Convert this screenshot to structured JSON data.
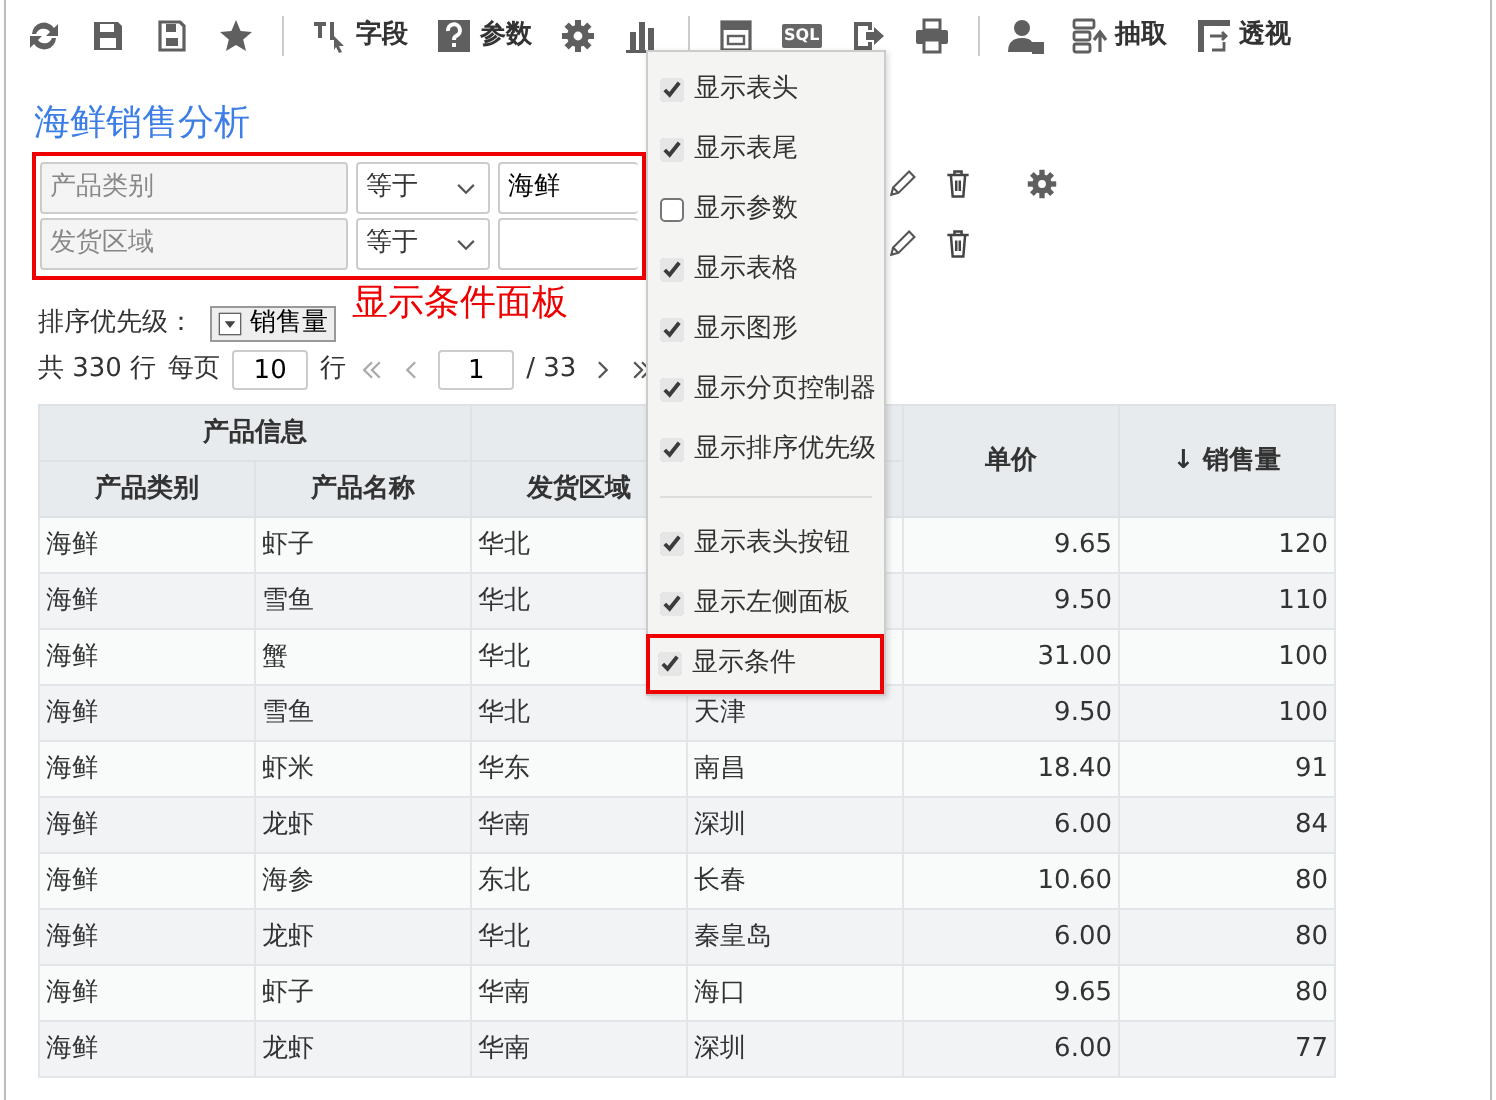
{
  "toolbar": {
    "fields_label": "字段",
    "params_label": "参数",
    "sql_text": "SQL",
    "extract_label": "抽取",
    "pivot_label": "透视"
  },
  "title": "海鲜销售分析",
  "conditions": [
    {
      "placeholder": "产品类别",
      "operator": "等于",
      "value": "海鲜",
      "has_settings": true
    },
    {
      "placeholder": "发货区域",
      "operator": "等于",
      "has_settings": false
    }
  ],
  "conditions_highlighted": true,
  "annotation": "显示条件面板",
  "sort": {
    "label": "排序优先级：",
    "field": "销售量"
  },
  "pagination": {
    "total": "共 330 行",
    "per_page_label": "每页",
    "per_page": "10",
    "rows_unit": "行",
    "page": "1",
    "pages": "/ 33"
  },
  "table": {
    "group_header": "产品信息",
    "columns": [
      "产品类别",
      "产品名称",
      "发货区域"
    ],
    "price_header": "单价",
    "sales_header": "销售量",
    "sort_arrow": "↓",
    "rows": [
      [
        "海鲜",
        "虾子",
        "华北",
        null,
        "9.65",
        "120"
      ],
      [
        "海鲜",
        "雪鱼",
        "华北",
        null,
        "9.50",
        "110"
      ],
      [
        "海鲜",
        "蟹",
        "华北",
        null,
        "31.00",
        "100"
      ],
      [
        "海鲜",
        "雪鱼",
        "华北",
        "天津",
        "9.50",
        "100"
      ],
      [
        "海鲜",
        "虾米",
        "华东",
        "南昌",
        "18.40",
        "91"
      ],
      [
        "海鲜",
        "龙虾",
        "华南",
        "深圳",
        "6.00",
        "84"
      ],
      [
        "海鲜",
        "海参",
        "东北",
        "长春",
        "10.60",
        "80"
      ],
      [
        "海鲜",
        "龙虾",
        "华北",
        "秦皇岛",
        "6.00",
        "80"
      ],
      [
        "海鲜",
        "虾子",
        "华南",
        "海口",
        "9.65",
        "80"
      ],
      [
        "海鲜",
        "龙虾",
        "华南",
        "深圳",
        "6.00",
        "77"
      ]
    ]
  },
  "menu": {
    "groups": [
      [
        {
          "label": "显示表头",
          "checked": true,
          "highlighted": false
        },
        {
          "label": "显示表尾",
          "checked": true,
          "highlighted": false
        },
        {
          "label": "显示参数",
          "checked": false,
          "highlighted": false
        },
        {
          "label": "显示表格",
          "checked": true,
          "highlighted": false
        },
        {
          "label": "显示图形",
          "checked": true,
          "highlighted": false
        },
        {
          "label": "显示分页控制器",
          "checked": true,
          "highlighted": false
        },
        {
          "label": "显示排序优先级",
          "checked": true,
          "highlighted": false
        }
      ],
      [
        {
          "label": "显示表头按钮",
          "checked": true,
          "highlighted": false
        },
        {
          "label": "显示左侧面板",
          "checked": true,
          "highlighted": false
        },
        {
          "label": "显示条件",
          "checked": true,
          "highlighted": true
        }
      ]
    ]
  }
}
